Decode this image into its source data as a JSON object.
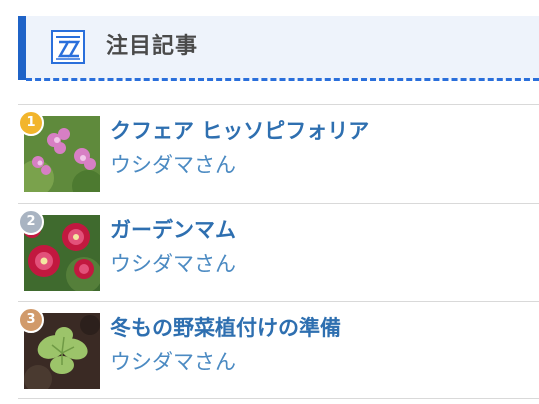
{
  "widget": {
    "title": "注目記事",
    "header_icon": "newspaper-icon",
    "colors": {
      "accent": "#1f63c7",
      "header_bg": "#eef3fb",
      "title_link": "#2e6fb0",
      "author_link": "#4b8ac2",
      "rank_gold": "#f2b52c",
      "rank_silver": "#a9b4c2",
      "rank_bronze": "#d19a6a"
    }
  },
  "articles": [
    {
      "rank": "1",
      "title": "クフェア ヒッソピフォリア",
      "author": "ウシダマさん",
      "thumbnail": "pink-flowers-photo"
    },
    {
      "rank": "2",
      "title": "ガーデンマム",
      "author": "ウシダマさん",
      "thumbnail": "red-mums-photo"
    },
    {
      "rank": "3",
      "title": "冬もの野菜植付けの準備",
      "author": "ウシダマさん",
      "thumbnail": "seedling-photo"
    }
  ]
}
